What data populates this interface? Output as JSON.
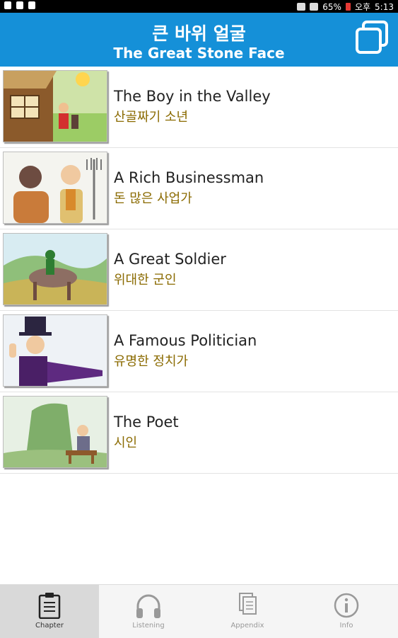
{
  "status_bar": {
    "battery": "65%",
    "period": "오후",
    "time": "5:13"
  },
  "header": {
    "title_korean": "큰 바위 얼굴",
    "title_english": "The Great Stone Face",
    "action_icon": "copy-icon"
  },
  "chapters": [
    {
      "title": "The Boy in the Valley",
      "subtitle": "산골짜기 소년"
    },
    {
      "title": "A Rich Businessman",
      "subtitle": "돈 많은 사업가"
    },
    {
      "title": "A Great Soldier",
      "subtitle": "위대한 군인"
    },
    {
      "title": "A Famous Politician",
      "subtitle": "유명한 정치가"
    },
    {
      "title": "The Poet",
      "subtitle": "시인"
    }
  ],
  "tabs": [
    {
      "label": "Chapter",
      "icon": "clipboard-icon",
      "active": true
    },
    {
      "label": "Listening",
      "icon": "headphones-icon",
      "active": false
    },
    {
      "label": "Appendix",
      "icon": "documents-icon",
      "active": false
    },
    {
      "label": "Info",
      "icon": "info-icon",
      "active": false
    }
  ],
  "colors": {
    "header": "#1590d8",
    "subtitle": "#8a6a00",
    "tab_active": "#d9d9d9"
  }
}
